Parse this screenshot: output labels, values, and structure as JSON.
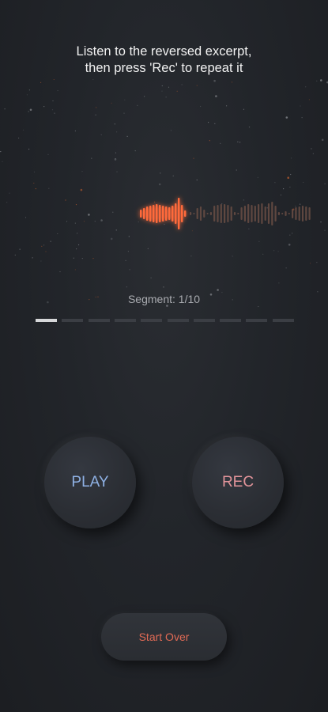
{
  "instruction": {
    "line1": "Listen to the reversed excerpt,",
    "line2": "then press 'Rec' to repeat it"
  },
  "segment": {
    "label": "Segment: 1/10",
    "current": 1,
    "total": 10
  },
  "buttons": {
    "play": "PLAY",
    "rec": "REC",
    "start_over": "Start Over"
  },
  "colors": {
    "accent_orange": "#ff6a3a",
    "play_text": "#8fb1e4",
    "rec_text": "#e2949a",
    "start_over_text": "#e06a55"
  }
}
